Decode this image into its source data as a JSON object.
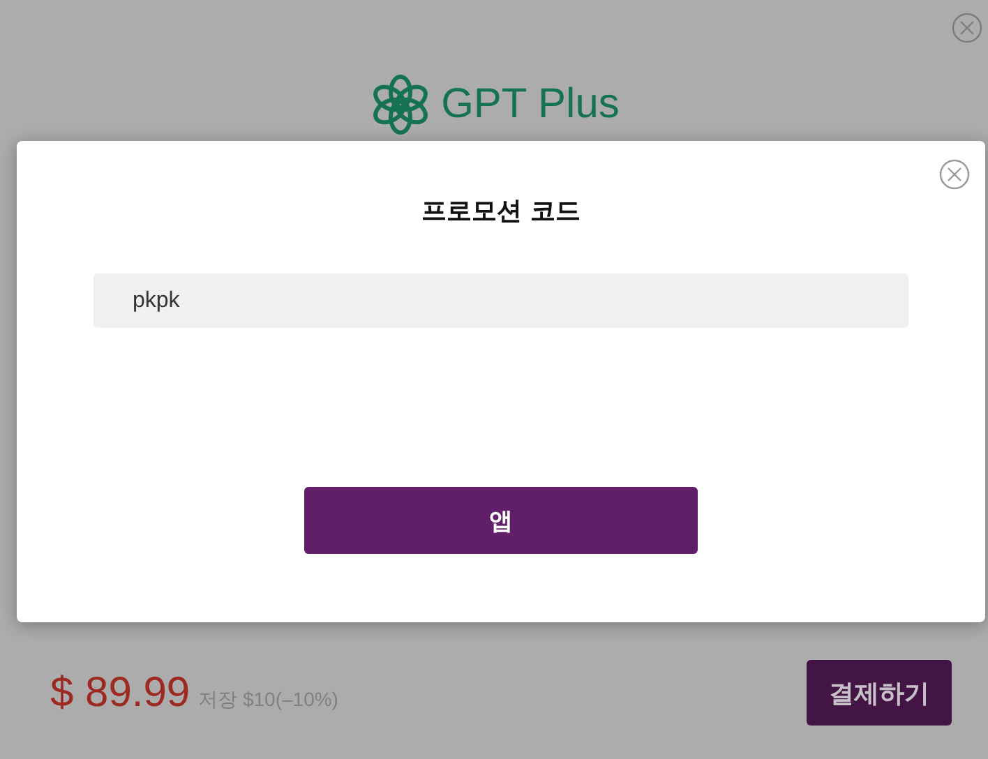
{
  "page": {
    "brand": "GPT Plus",
    "price": "$ 89.99",
    "savings": "저장 $10(–10%)",
    "pay_button": "결제하기"
  },
  "dialog": {
    "title": "프로모션 코드",
    "code_field": {
      "value": "pkpk"
    },
    "apply_button": "앱"
  }
}
